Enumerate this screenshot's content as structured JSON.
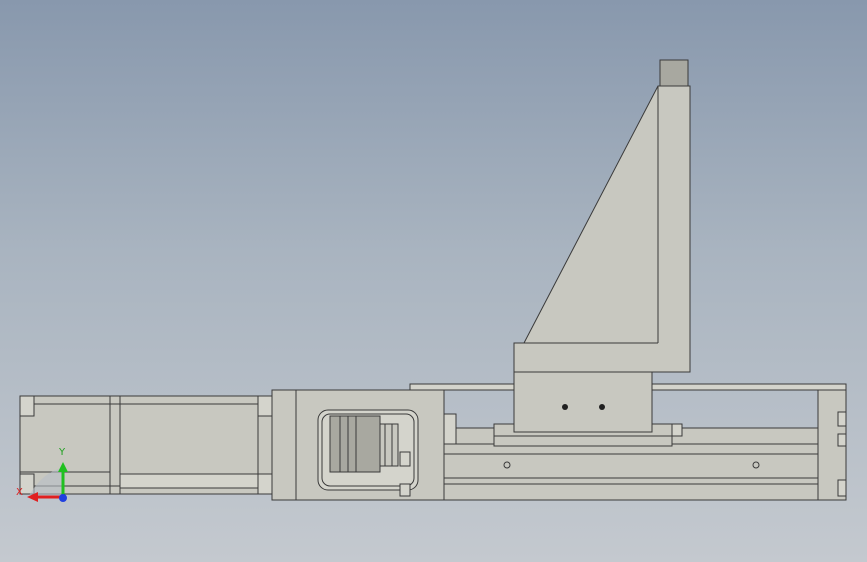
{
  "triad": {
    "y_label": "Y",
    "x_label": "X",
    "colors": {
      "x": "#e02020",
      "y": "#20c020",
      "z": "#2040e0"
    }
  },
  "colors": {
    "background_top": "#8898ad",
    "background_bottom": "#c4c9cf",
    "part_fill": "#c8c8c0",
    "edge": "#3a3a3a"
  }
}
